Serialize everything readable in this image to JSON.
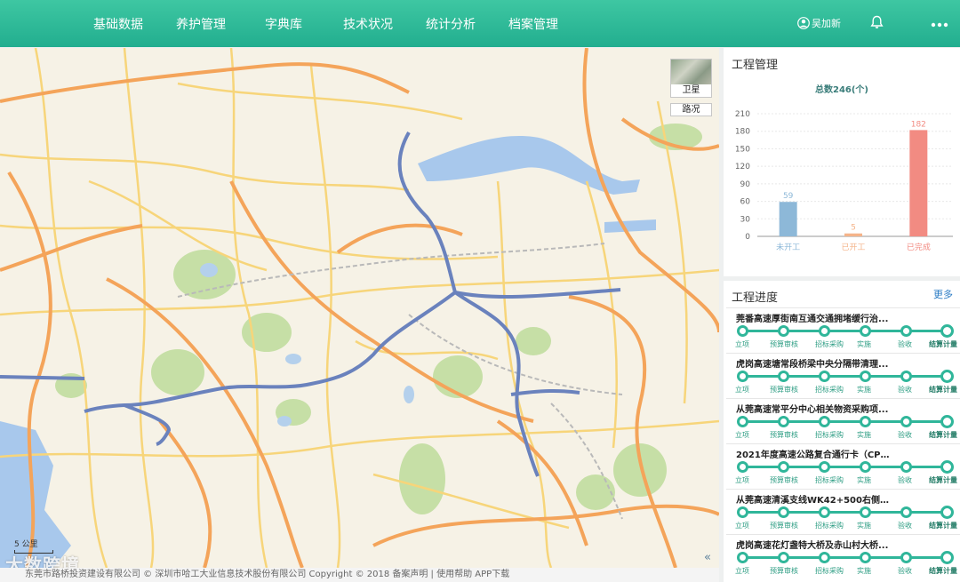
{
  "nav": [
    "基础数据",
    "养护管理",
    "字典库",
    "技术状况",
    "统计分析",
    "档案管理"
  ],
  "user": {
    "name": "吴加新",
    "icon": "user-icon"
  },
  "icons": {
    "bell": "bell-icon",
    "more": "more-icon"
  },
  "map": {
    "satellite_label": "卫星",
    "road_label": "路况",
    "scale_label": "5 公里",
    "watermark": "大数跨境",
    "collapse_glyph": "«"
  },
  "footer": "东莞市路桥投资建设有限公司 © 深圳市哈工大业信息技术股份有限公司 Copyright © 2018 备案声明 | 使用帮助 APP下载",
  "colors": {
    "accent": "#22ae8f",
    "bar_not_started": "#8db8d8",
    "bar_started": "#f5b48a",
    "bar_completed": "#f28b82"
  },
  "project_management": {
    "title": "工程管理",
    "total": "总数246(个)",
    "chart_data": {
      "type": "bar",
      "categories": [
        "未开工",
        "已开工",
        "已完成"
      ],
      "values": [
        59,
        5,
        182
      ],
      "ylim": [
        0,
        210
      ],
      "yticks": [
        0,
        30,
        60,
        90,
        120,
        150,
        180,
        210
      ],
      "grid": true
    }
  },
  "progress": {
    "title": "工程进度",
    "more": "更多",
    "stages": [
      "立项",
      "预算审核",
      "招标采购",
      "实施",
      "验收",
      "结算计量"
    ],
    "projects": [
      {
        "name": "莞番高速厚街南互通交通拥堵缓行治..."
      },
      {
        "name": "虎岗高速塘常段桥梁中央分隔带清理..."
      },
      {
        "name": "从莞高速常平分中心相关物资采购项..."
      },
      {
        "name": "2021年度高速公路复合通行卡（CPC..."
      },
      {
        "name": "从莞高速清溪支线WK42+500右侧二..."
      },
      {
        "name": "虎岗高速花灯盏特大桥及赤山村大桥..."
      }
    ]
  }
}
